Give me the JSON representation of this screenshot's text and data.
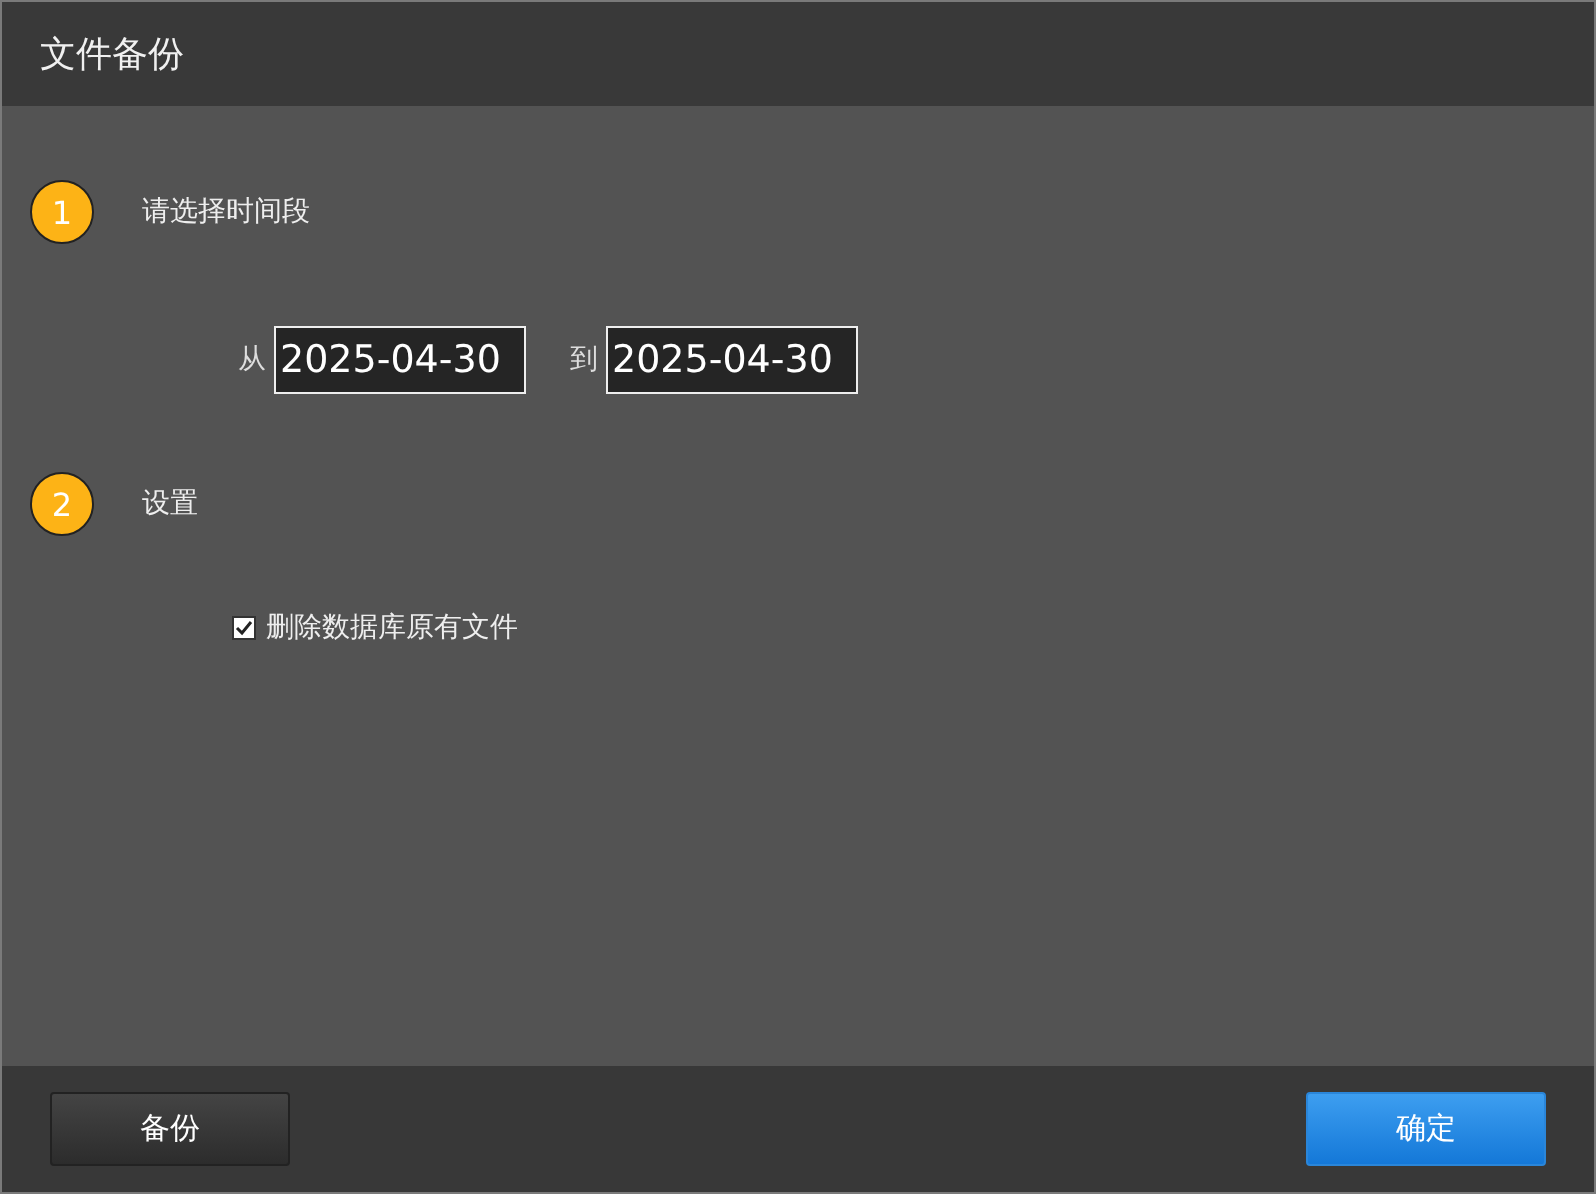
{
  "window": {
    "title": "文件备份"
  },
  "steps": [
    {
      "number": "1",
      "label": "请选择时间段",
      "kind": "daterange",
      "from_label": "从",
      "from_value": "2025-04-30",
      "to_label": "到",
      "to_value": "2025-04-30"
    },
    {
      "number": "2",
      "label": "设置",
      "kind": "options",
      "options": [
        {
          "label": "删除数据库原有文件",
          "checked": true
        }
      ]
    }
  ],
  "buttons": [
    {
      "label": "备份",
      "kind": "secondary"
    },
    {
      "label": "确定",
      "kind": "primary"
    }
  ]
}
